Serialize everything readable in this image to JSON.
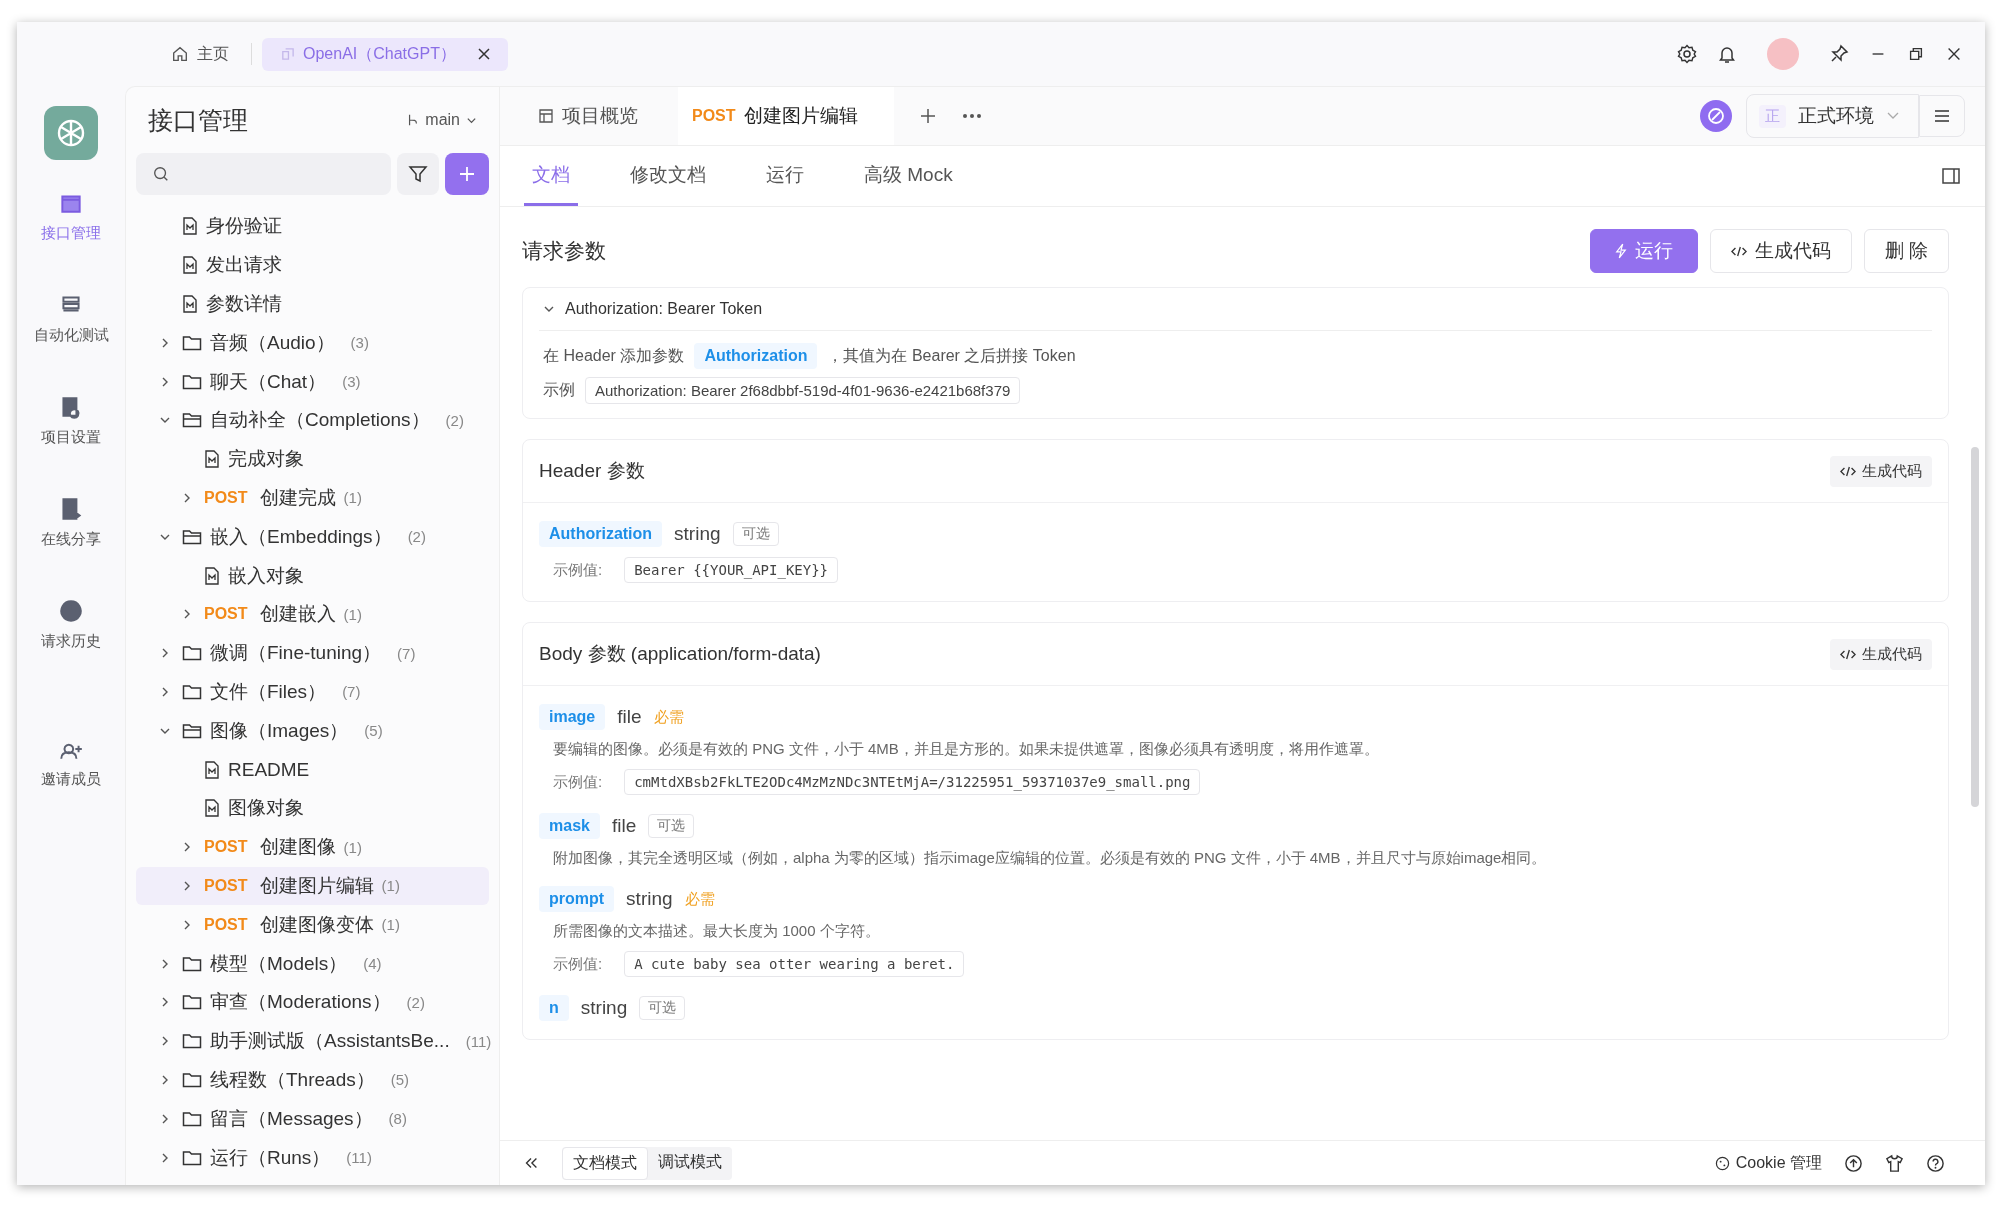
{
  "window_tabs": [
    {
      "label": "主页",
      "kind": "home",
      "selected": false
    },
    {
      "label": "OpenAI（ChatGPT）",
      "kind": "project",
      "selected": true
    }
  ],
  "nav": [
    {
      "label": "接口管理",
      "kind": "api",
      "selected": true
    },
    {
      "label": "自动化测试",
      "kind": "test",
      "selected": false
    },
    {
      "label": "项目设置",
      "kind": "settings",
      "selected": false
    },
    {
      "label": "在线分享",
      "kind": "share",
      "selected": false
    },
    {
      "label": "请求历史",
      "kind": "history",
      "selected": false
    },
    {
      "label": "邀请成员",
      "kind": "invite",
      "selected": false
    }
  ],
  "sidebar": {
    "title": "接口管理",
    "branch": "main",
    "tree": [
      {
        "kind": "doc",
        "label": "身份验证",
        "selected": false
      },
      {
        "kind": "doc",
        "label": "发出请求",
        "selected": false
      },
      {
        "kind": "doc",
        "label": "参数详情",
        "selected": false
      },
      {
        "kind": "folder",
        "label": "音频（Audio）",
        "count": "(3)",
        "expanded": false,
        "selected": false
      },
      {
        "kind": "folder",
        "label": "聊天（Chat）",
        "count": "(3)",
        "expanded": false,
        "selected": false
      },
      {
        "kind": "folder",
        "label": "自动补全（Completions）",
        "count": "(2)",
        "expanded": true,
        "selected": false,
        "children": [
          {
            "kind": "doc",
            "label": "完成对象",
            "selected": false
          },
          {
            "kind": "endpoint",
            "method": "POST",
            "label": "创建完成",
            "count": "(1)",
            "expanded": false,
            "selected": false
          }
        ]
      },
      {
        "kind": "folder",
        "label": "嵌入（Embeddings）",
        "count": "(2)",
        "expanded": true,
        "selected": false,
        "children": [
          {
            "kind": "doc",
            "label": "嵌入对象",
            "selected": false
          },
          {
            "kind": "endpoint",
            "method": "POST",
            "label": "创建嵌入",
            "count": "(1)",
            "expanded": false,
            "selected": false
          }
        ]
      },
      {
        "kind": "folder",
        "label": "微调（Fine-tuning）",
        "count": "(7)",
        "expanded": false,
        "selected": false
      },
      {
        "kind": "folder",
        "label": "文件（Files）",
        "count": "(7)",
        "expanded": false,
        "selected": false
      },
      {
        "kind": "folder",
        "label": "图像（Images）",
        "count": "(5)",
        "expanded": true,
        "selected": false,
        "children": [
          {
            "kind": "doc",
            "label": "README",
            "selected": false
          },
          {
            "kind": "doc",
            "label": "图像对象",
            "selected": false
          },
          {
            "kind": "endpoint",
            "method": "POST",
            "label": "创建图像",
            "count": "(1)",
            "expanded": false,
            "selected": false
          },
          {
            "kind": "endpoint",
            "method": "POST",
            "label": "创建图片编辑",
            "count": "(1)",
            "expanded": false,
            "selected": true
          },
          {
            "kind": "endpoint",
            "method": "POST",
            "label": "创建图像变体",
            "count": "(1)",
            "expanded": false,
            "selected": false
          }
        ]
      },
      {
        "kind": "folder",
        "label": "模型（Models）",
        "count": "(4)",
        "expanded": false,
        "selected": false
      },
      {
        "kind": "folder",
        "label": "审查（Moderations）",
        "count": "(2)",
        "expanded": false,
        "selected": false
      },
      {
        "kind": "folder",
        "label": "助手测试版（AssistantsBe...",
        "count": "(11)",
        "expanded": false,
        "selected": false
      },
      {
        "kind": "folder",
        "label": "线程数（Threads）",
        "count": "(5)",
        "expanded": false,
        "selected": false
      },
      {
        "kind": "folder",
        "label": "留言（Messages）",
        "count": "(8)",
        "expanded": false,
        "selected": false
      },
      {
        "kind": "folder",
        "label": "运行（Runs）",
        "count": "(11)",
        "expanded": false,
        "selected": false
      }
    ]
  },
  "doc_tabs": [
    {
      "kind": "overview",
      "label": "项目概览",
      "selected": false
    },
    {
      "kind": "endpoint",
      "method": "POST",
      "label": "创建图片编辑",
      "selected": true
    }
  ],
  "environment": {
    "badge": "正",
    "label": "正式环境"
  },
  "sub_tabs": [
    {
      "label": "文档",
      "selected": true
    },
    {
      "label": "修改文档",
      "selected": false
    },
    {
      "label": "运行",
      "selected": false
    },
    {
      "label": "高级 Mock",
      "selected": false
    }
  ],
  "section_title": "请求参数",
  "actions": [
    {
      "kind": "primary",
      "label": "运行"
    },
    {
      "kind": "code",
      "label": "生成代码"
    },
    {
      "kind": "plain",
      "label": "删 除"
    }
  ],
  "auth": {
    "title": "Authorization: Bearer Token",
    "expanded": true,
    "before": "在 Header 添加参数",
    "tag": "Authorization",
    "after": "，其值为在 Bearer 之后拼接 Token",
    "example_label": "示例",
    "example": "Authorization: Bearer 2f68dbbf-519d-4f01-9636-e2421b68f379"
  },
  "param_cards": [
    {
      "title": "Header 参数",
      "button": "生成代码",
      "params": [
        {
          "name": "Authorization",
          "type": "string",
          "required": false,
          "badge": "可选",
          "example_label": "示例值:",
          "example": "Bearer {{YOUR_API_KEY}}"
        }
      ]
    },
    {
      "title": "Body 参数 (application/form-data)",
      "button": "生成代码",
      "params": [
        {
          "name": "image",
          "type": "file",
          "required": true,
          "badge": "必需",
          "description": "要编辑的图像。必须是有效的 PNG 文件，小于 4MB，并且是方形的。如果未提供遮罩，图像必须具有透明度，将用作遮罩。",
          "example_label": "示例值:",
          "example": "cmMtdXBsb2FkLTE2ODc4MzMzNDc3NTEtMjA=/31225951_59371037e9_small.png"
        },
        {
          "name": "mask",
          "type": "file",
          "required": false,
          "badge": "可选",
          "description": "附加图像，其完全透明区域（例如，alpha 为零的区域）指示image应编辑的位置。必须是有效的 PNG 文件，小于 4MB，并且尺寸与原始image相同。"
        },
        {
          "name": "prompt",
          "type": "string",
          "required": true,
          "badge": "必需",
          "description": "所需图像的文本描述。最大长度为 1000 个字符。",
          "example_label": "示例值:",
          "example": "A cute baby sea otter wearing a beret."
        },
        {
          "name": "n",
          "type": "string",
          "required": false,
          "badge": "可选"
        }
      ]
    }
  ],
  "footer": {
    "modes": [
      {
        "label": "文档模式",
        "selected": true
      },
      {
        "label": "调试模式",
        "selected": false
      }
    ],
    "cookie": "Cookie 管理"
  }
}
